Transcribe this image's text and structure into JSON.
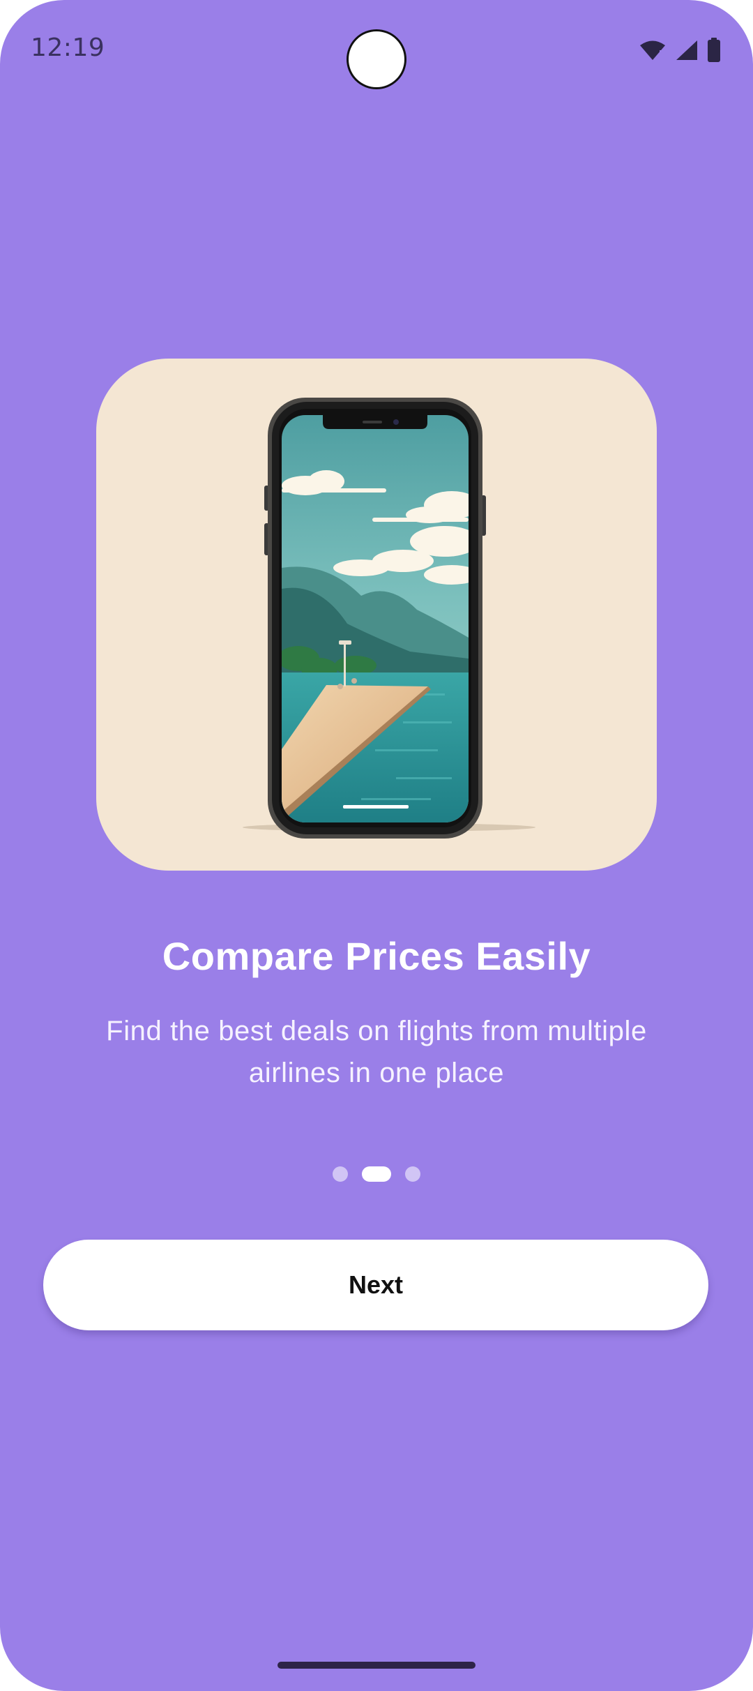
{
  "status_bar": {
    "time": "12:19",
    "icons": [
      "wifi-icon",
      "signal-icon",
      "battery-icon"
    ]
  },
  "onboarding": {
    "illustration": "phone-with-seaside-pier-illustration",
    "title": "Compare Prices Easily",
    "description": "Find the best deals on flights from multiple airlines in one place",
    "page_indicator": {
      "total": 3,
      "current_index": 1
    },
    "next_label": "Next"
  },
  "colors": {
    "background": "#9a7fe8",
    "card_background": "#f4e6d3",
    "button_background": "#ffffff",
    "text_primary": "#ffffff"
  }
}
